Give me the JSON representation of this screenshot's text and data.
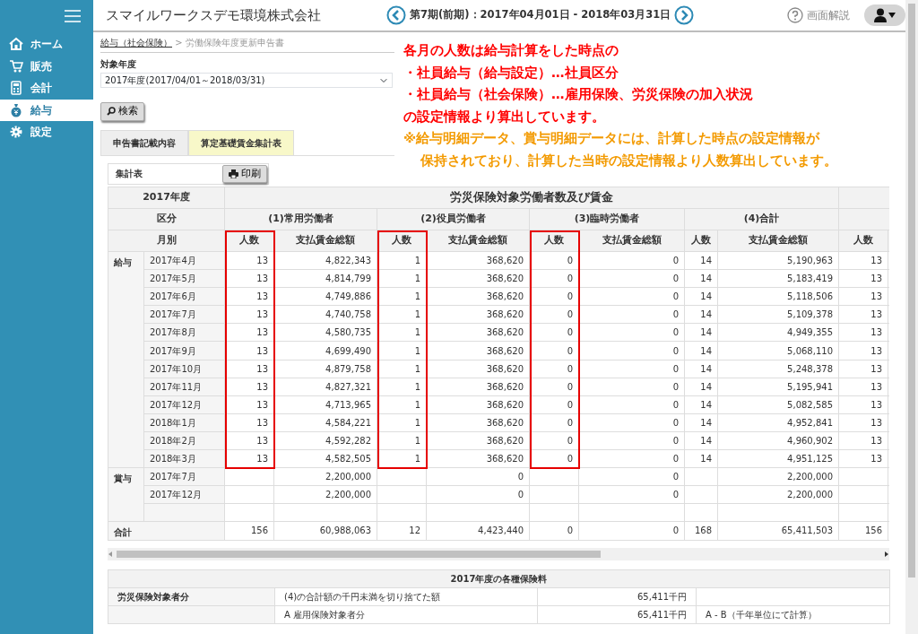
{
  "sidebar": {
    "items": [
      {
        "label": "ホーム",
        "selected": false
      },
      {
        "label": "販売",
        "selected": false
      },
      {
        "label": "会計",
        "selected": false
      },
      {
        "label": "給与",
        "selected": true
      },
      {
        "label": "設定",
        "selected": false
      }
    ]
  },
  "header": {
    "company": "スマイルワークスデモ環境株式会社",
    "period": "第7期(前期)：2017年04月01日 - 2018年03月31日",
    "help": "画面解説"
  },
  "breadcrumb": {
    "link": "給与（社会保険）",
    "separator": ">",
    "current": "労働保険年度更新申告書"
  },
  "filter": {
    "label": "対象年度",
    "value": "2017年度(2017/04/01～2018/03/31)",
    "button": "検索"
  },
  "tabs": [
    {
      "label": "申告書記載内容",
      "selected": false
    },
    {
      "label": "算定基礎賃金集計表",
      "selected": true
    }
  ],
  "panel": {
    "title": "集計表",
    "print_button": "印刷"
  },
  "table": {
    "corner": "2017年度",
    "span_label": "労災保険対象労働者数及び賃金",
    "category_label": "区分",
    "groups": [
      "(1)常用労働者",
      "(2)役員労働者",
      "(3)臨時労働者",
      "(4)合計"
    ],
    "month_label": "月別",
    "columns": [
      {
        "label": "人数",
        "highlighted": true
      },
      {
        "label": "支払賃金総額",
        "highlighted": false
      },
      {
        "label": "人数",
        "highlighted": true
      },
      {
        "label": "支払賃金総額",
        "highlighted": false
      },
      {
        "label": "人数",
        "highlighted": true
      },
      {
        "label": "支払賃金総額",
        "highlighted": false
      },
      {
        "label": "人数",
        "highlighted": false
      },
      {
        "label": "支払賃金総額",
        "highlighted": false
      },
      {
        "label": "人数",
        "highlighted": false
      }
    ],
    "row_groups": [
      {
        "label": "給与",
        "rows": [
          {
            "month": "2017年4月",
            "cells": [
              "13",
              "4,822,343",
              "1",
              "368,620",
              "0",
              "0",
              "14",
              "5,190,963",
              "13"
            ]
          },
          {
            "month": "2017年5月",
            "cells": [
              "13",
              "4,814,799",
              "1",
              "368,620",
              "0",
              "0",
              "14",
              "5,183,419",
              "13"
            ]
          },
          {
            "month": "2017年6月",
            "cells": [
              "13",
              "4,749,886",
              "1",
              "368,620",
              "0",
              "0",
              "14",
              "5,118,506",
              "13"
            ]
          },
          {
            "month": "2017年7月",
            "cells": [
              "13",
              "4,740,758",
              "1",
              "368,620",
              "0",
              "0",
              "14",
              "5,109,378",
              "13"
            ]
          },
          {
            "month": "2017年8月",
            "cells": [
              "13",
              "4,580,735",
              "1",
              "368,620",
              "0",
              "0",
              "14",
              "4,949,355",
              "13"
            ]
          },
          {
            "month": "2017年9月",
            "cells": [
              "13",
              "4,699,490",
              "1",
              "368,620",
              "0",
              "0",
              "14",
              "5,068,110",
              "13"
            ]
          },
          {
            "month": "2017年10月",
            "cells": [
              "13",
              "4,879,758",
              "1",
              "368,620",
              "0",
              "0",
              "14",
              "5,248,378",
              "13"
            ]
          },
          {
            "month": "2017年11月",
            "cells": [
              "13",
              "4,827,321",
              "1",
              "368,620",
              "0",
              "0",
              "14",
              "5,195,941",
              "13"
            ]
          },
          {
            "month": "2017年12月",
            "cells": [
              "13",
              "4,713,965",
              "1",
              "368,620",
              "0",
              "0",
              "14",
              "5,082,585",
              "13"
            ]
          },
          {
            "month": "2018年1月",
            "cells": [
              "13",
              "4,584,221",
              "1",
              "368,620",
              "0",
              "0",
              "14",
              "4,952,841",
              "13"
            ]
          },
          {
            "month": "2018年2月",
            "cells": [
              "13",
              "4,592,282",
              "1",
              "368,620",
              "0",
              "0",
              "14",
              "4,960,902",
              "13"
            ]
          },
          {
            "month": "2018年3月",
            "cells": [
              "13",
              "4,582,505",
              "1",
              "368,620",
              "0",
              "0",
              "14",
              "4,951,125",
              "13"
            ]
          }
        ]
      },
      {
        "label": "賞与",
        "rows": [
          {
            "month": "2017年7月",
            "cells": [
              null,
              "2,200,000",
              null,
              "0",
              null,
              "0",
              null,
              "2,200,000",
              null
            ]
          },
          {
            "month": "2017年12月",
            "cells": [
              null,
              "2,200,000",
              null,
              "0",
              null,
              "0",
              null,
              "2,200,000",
              null
            ]
          },
          {
            "month": null,
            "cells": [
              null,
              null,
              null,
              null,
              null,
              null,
              null,
              null,
              null
            ]
          }
        ]
      }
    ],
    "total": {
      "label": "合計",
      "cells": [
        "156",
        "60,988,063",
        "12",
        "4,423,440",
        "0",
        "0",
        "168",
        "65,411,503",
        "156"
      ]
    }
  },
  "premiums": {
    "title": "2017年度の各種保険料",
    "rows": [
      {
        "cells": [
          "労災保険対象者分",
          "(4)の合計額の千円未満を切り捨てた額",
          "65,411千円",
          null
        ]
      },
      {
        "cells": [
          null,
          "A 雇用保険対象者分",
          "65,411千円",
          "A - B（千年単位にて計算）"
        ]
      }
    ]
  },
  "annotation": {
    "lines": [
      {
        "kind": "main",
        "text": "各月の人数は給与計算をした時点の"
      },
      {
        "kind": "main",
        "text": "・社員給与（給与設定）…社員区分"
      },
      {
        "kind": "main",
        "text": "・社員給与（社会保険）…雇用保険、労災保険の加入状況"
      },
      {
        "kind": "main",
        "text": "の設定情報より算出しています。"
      },
      {
        "kind": "note",
        "text": "※給与明細データ、賞与明細データには、計算した時点の設定情報が"
      },
      {
        "kind": "note-cont",
        "text": "保持されており、計算した当時の設定情報より人数算出しています。"
      }
    ]
  }
}
